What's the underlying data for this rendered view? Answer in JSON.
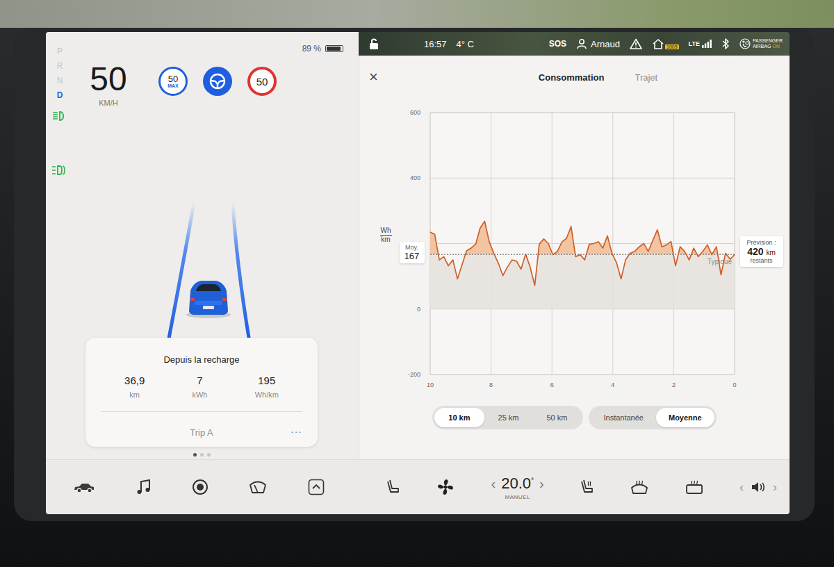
{
  "drive": {
    "gears": [
      {
        "letter": "P",
        "selected": false
      },
      {
        "letter": "R",
        "selected": false
      },
      {
        "letter": "N",
        "selected": false
      },
      {
        "letter": "D",
        "selected": true
      }
    ],
    "indicators": [
      {
        "kind": "headlight",
        "on": true
      },
      {
        "kind": "parking",
        "on": true
      }
    ],
    "battery": {
      "text": "89 %",
      "level": 0.89
    },
    "speed": "50",
    "speed_unit": "KM/H",
    "cruise": {
      "speed": "50",
      "label": "MAX"
    },
    "autosteer": {
      "active": true
    },
    "speed_sign": "50"
  },
  "trip_card": {
    "title": "Depuis la recharge",
    "stats": [
      {
        "value": "36,9",
        "unit": "km"
      },
      {
        "value": "7",
        "unit": "kWh"
      },
      {
        "value": "195",
        "unit": "Wh/km"
      }
    ],
    "name": "Trip A",
    "more": "···",
    "pages": [
      {
        "selected": true
      },
      {
        "selected": false
      },
      {
        "selected": false
      }
    ]
  },
  "status_bar": {
    "time": "16:57",
    "outside_temp": "4° C",
    "sos": "SOS",
    "user": "Arnaud",
    "home_badge": "1009",
    "network": "LTE",
    "airbag": {
      "line1": "PASSENGER",
      "line2": "AIRBAG",
      "state": "ON"
    }
  },
  "consumption": {
    "close": "×",
    "tabs": [
      {
        "label": "Consommation",
        "selected": true
      },
      {
        "label": "Trajet",
        "selected": false
      }
    ],
    "y_axis": {
      "min": -200,
      "max": 600,
      "grid": [
        600,
        400,
        200,
        0,
        -200
      ],
      "ticks": [
        "600",
        "400",
        "0",
        "-200"
      ],
      "unit_top": "Wh",
      "unit_bottom": "km"
    },
    "x_axis": {
      "max": 10,
      "ticks": [
        "10",
        "8",
        "6",
        "4",
        "2",
        "0"
      ]
    },
    "average": {
      "label": "Moy.",
      "value": "167"
    },
    "typical_label": "Typique",
    "forecast": {
      "label": "Prévision :",
      "value": "420",
      "unit": "km",
      "suffix": "restants"
    },
    "series": [
      235,
      228,
      150,
      160,
      132,
      150,
      92,
      135,
      178,
      186,
      198,
      248,
      268,
      205,
      170,
      140,
      102,
      128,
      150,
      146,
      122,
      168,
      128,
      72,
      198,
      214,
      200,
      166,
      176,
      205,
      216,
      252,
      160,
      166,
      150,
      198,
      200,
      206,
      186,
      224,
      170,
      142,
      92,
      150,
      170,
      176,
      190,
      200,
      176,
      210,
      242,
      190,
      196,
      206,
      132,
      190,
      176,
      150,
      186,
      160,
      176,
      196,
      166,
      190,
      104,
      170,
      152,
      166
    ],
    "ranges": [
      {
        "label": "10 km",
        "selected": true
      },
      {
        "label": "25 km",
        "selected": false
      },
      {
        "label": "50 km",
        "selected": false
      }
    ],
    "modes": [
      {
        "label": "Instantanée",
        "selected": false
      },
      {
        "label": "Moyenne",
        "selected": true
      }
    ]
  },
  "climate": {
    "down": "‹",
    "temperature": "20.0",
    "degree": "°",
    "up": "›",
    "mode": "MANUEL"
  },
  "volume": {
    "down": "‹",
    "up": "›"
  }
}
